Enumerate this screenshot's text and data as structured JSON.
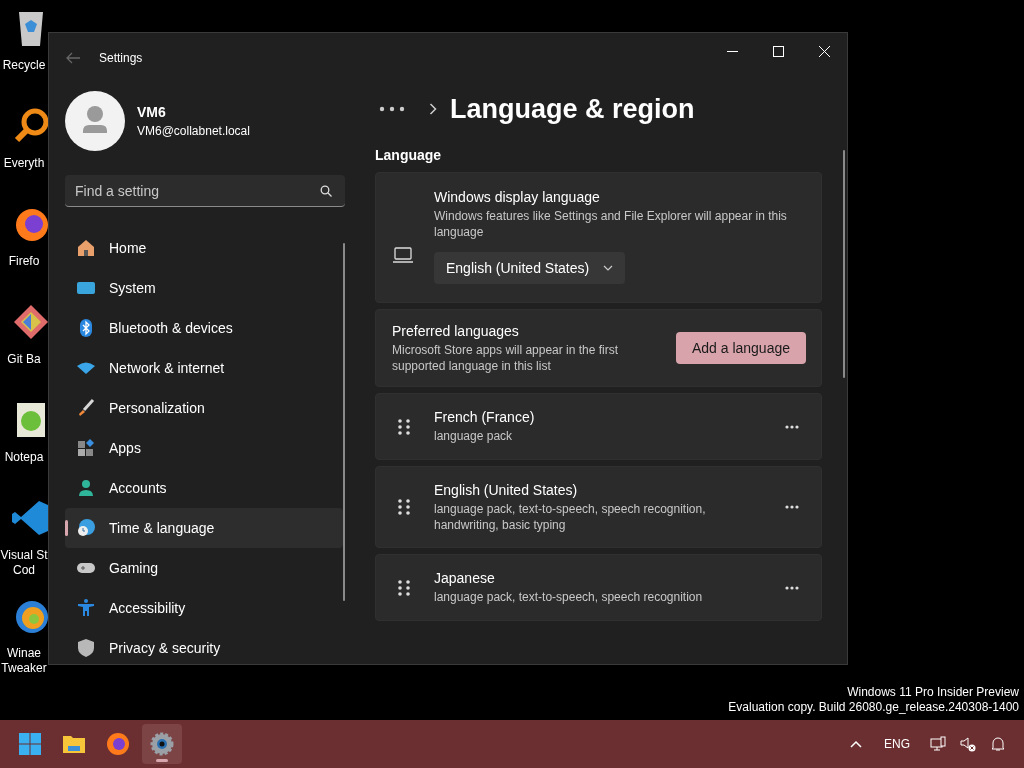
{
  "desktop_icons": [
    {
      "lines": [
        "Recycle"
      ]
    },
    {
      "lines": [
        "Everyth"
      ]
    },
    {
      "lines": [
        "Firefo"
      ]
    },
    {
      "lines": [
        "Git Ba"
      ]
    },
    {
      "lines": [
        "Notepa"
      ]
    },
    {
      "lines": [
        "Visual St",
        "Cod"
      ]
    },
    {
      "lines": [
        "Winae",
        "Tweaker"
      ]
    }
  ],
  "window": {
    "title": "Settings"
  },
  "user": {
    "name": "VM6",
    "email": "VM6@collabnet.local"
  },
  "search": {
    "placeholder": "Find a setting"
  },
  "nav": [
    {
      "label": "Home",
      "selected": false
    },
    {
      "label": "System",
      "selected": false
    },
    {
      "label": "Bluetooth & devices",
      "selected": false
    },
    {
      "label": "Network & internet",
      "selected": false
    },
    {
      "label": "Personalization",
      "selected": false
    },
    {
      "label": "Apps",
      "selected": false
    },
    {
      "label": "Accounts",
      "selected": false
    },
    {
      "label": "Time & language",
      "selected": true
    },
    {
      "label": "Gaming",
      "selected": false
    },
    {
      "label": "Accessibility",
      "selected": false
    },
    {
      "label": "Privacy & security",
      "selected": false
    }
  ],
  "page_title": "Language & region",
  "section": "Language",
  "display_language": {
    "title": "Windows display language",
    "description": "Windows features like Settings and File Explorer will appear in this language",
    "value": "English (United States)"
  },
  "preferred": {
    "title": "Preferred languages",
    "description": "Microsoft Store apps will appear in the first supported language in this list",
    "button": "Add a language"
  },
  "languages": [
    {
      "name": "French (France)",
      "features": "language pack"
    },
    {
      "name": "English (United States)",
      "features": "language pack, text-to-speech, speech recognition, handwriting, basic typing"
    },
    {
      "name": "Japanese",
      "features": "language pack, text-to-speech, speech recognition"
    }
  ],
  "watermark": [
    "Windows 11 Pro Insider Preview",
    "Evaluation copy. Build 26080.ge_release.240308-1400"
  ],
  "taskbar": {
    "apps": [
      {
        "selected": false
      },
      {
        "selected": false
      },
      {
        "selected": false
      },
      {
        "selected": true
      }
    ],
    "language": "ENG"
  }
}
